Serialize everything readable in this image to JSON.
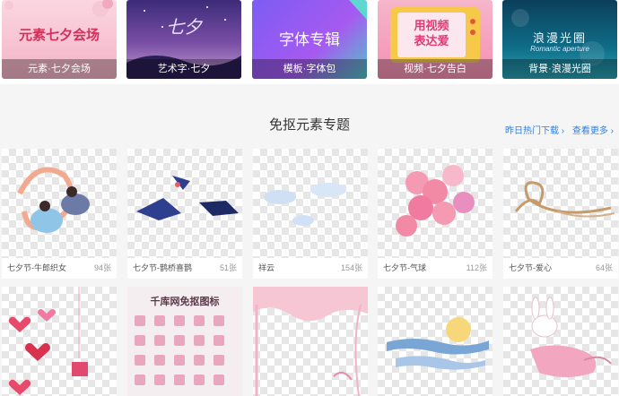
{
  "banners": [
    {
      "caption": "元素·七夕会场",
      "title": "元素七夕会场"
    },
    {
      "caption": "艺术字·七夕",
      "title": "七夕"
    },
    {
      "caption": "模板·字体包",
      "title": "字体专辑"
    },
    {
      "caption": "视频·七夕告白",
      "title_line1": "用视频",
      "title_line2": "表达爱"
    },
    {
      "caption": "背景·浪漫光圈",
      "title": "浪漫光圈",
      "subtitle": "Romantic aperture"
    }
  ],
  "section": {
    "title": "免抠元素专题",
    "link_hot": "昨日热门下载 ›",
    "link_more": "查看更多 ›"
  },
  "cards": [
    {
      "label": "七夕节-牛郎织女",
      "count": "94张"
    },
    {
      "label": "七夕节-鹊桥喜鹊",
      "count": "51张"
    },
    {
      "label": "祥云",
      "count": "154张"
    },
    {
      "label": "七夕节-气球",
      "count": "112张"
    },
    {
      "label": "七夕节-爱心",
      "count": "64张"
    }
  ],
  "icon_card": {
    "title": "千库网免抠图标"
  },
  "colors": {
    "accent_link": "#2f7fe0",
    "pink": "#f07aa0"
  }
}
